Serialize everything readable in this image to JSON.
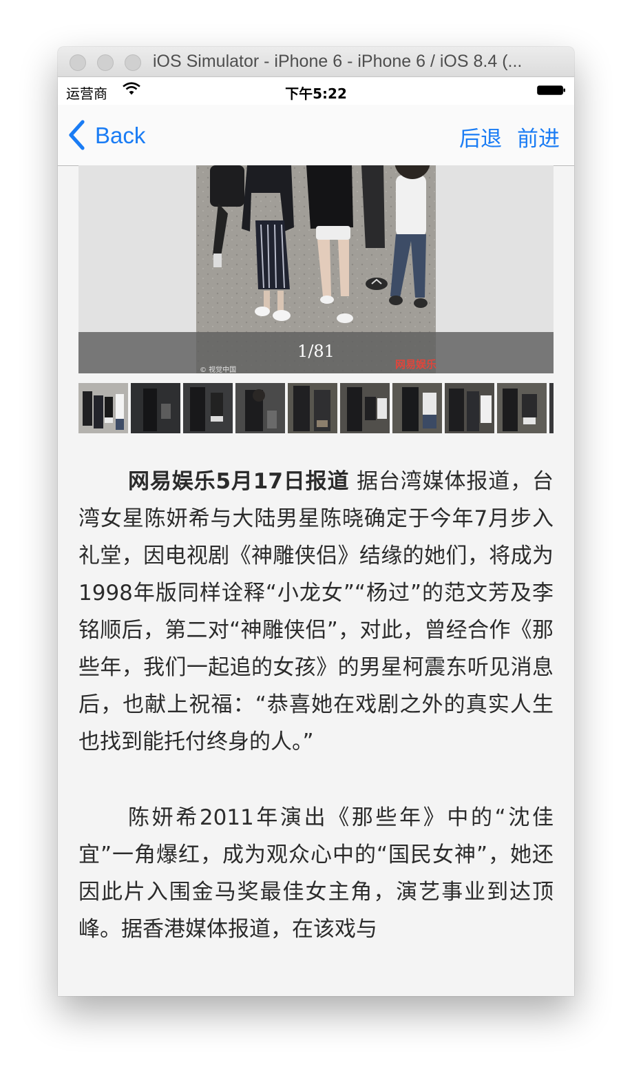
{
  "window": {
    "title": "iOS Simulator - iPhone 6 - iPhone 6 / iOS 8.4 (..."
  },
  "status_bar": {
    "carrier": "运营商",
    "time": "下午5:22"
  },
  "nav": {
    "back_label": "Back",
    "back_history": "后退",
    "forward": "前进"
  },
  "gallery": {
    "counter": "1/81",
    "watermark_left": "© 视觉中国",
    "watermark_right": "网易娱乐",
    "thumbnail_count": 9
  },
  "article": {
    "p1_lead": "网易娱乐5月17日报道",
    "p1_body": " 据台湾媒体报道，台湾女星陈妍希与大陆男星陈晓确定于今年7月步入礼堂，因电视剧《神雕侠侣》结缘的她们，将成为1998年版同样诠释“小龙女”“杨过”的范文芳及李铭顺后，第二对“神雕侠侣”，对此，曾经合作《那些年，我们一起追的女孩》的男星柯震东听见消息后，也献上祝福：“恭喜她在戏剧之外的真实人生也找到能托付终身的人。”",
    "p2": "陈妍希2011年演出《那些年》中的“沈佳宜”一角爆红，成为观众心中的“国民女神”，她还因此片入围金马奖最佳女主角，演艺事业到达顶峰。据香港媒体报道，在该戏与"
  },
  "colors": {
    "ios_blue": "#1a7cf4",
    "text": "#2b2b2b",
    "background": "#f4f4f4"
  }
}
